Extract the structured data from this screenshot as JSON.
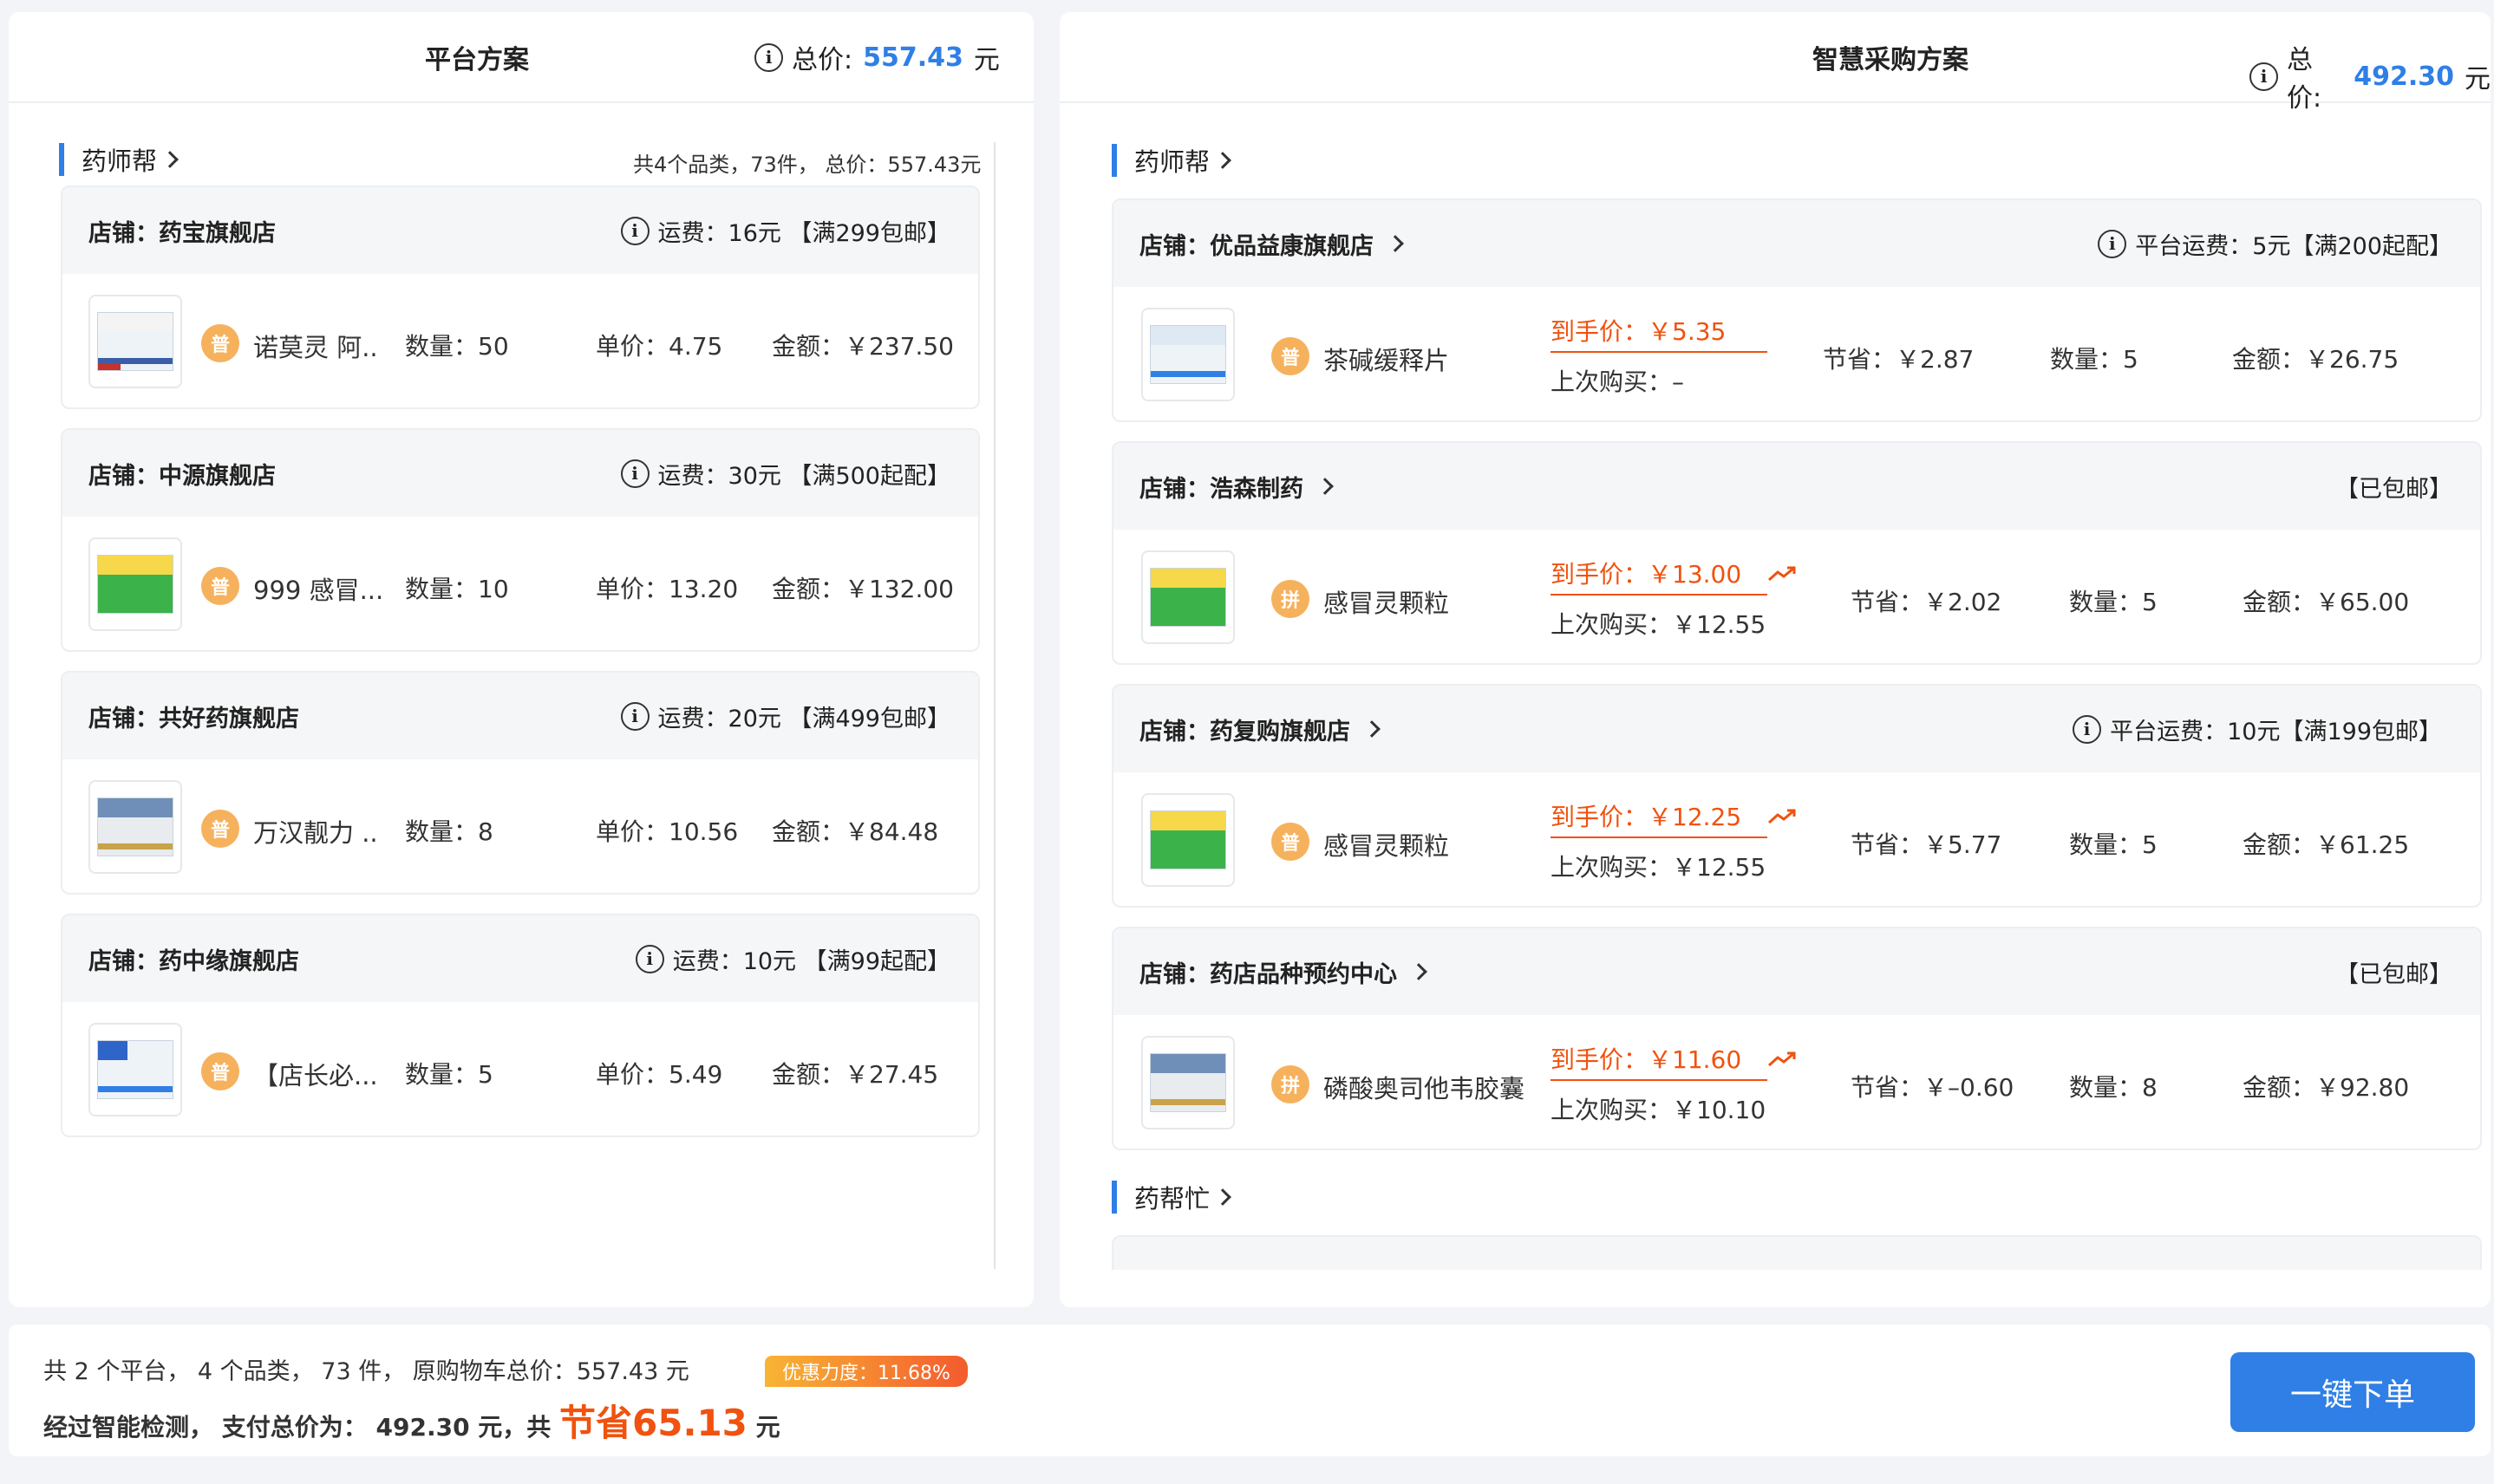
{
  "left": {
    "title": "平台方案",
    "total_label": "总价:",
    "total_value": "557.43",
    "unit": "元",
    "platform": "药师帮",
    "summary": "共4个品类，73件，  总价：557.43元",
    "stores": [
      {
        "name": "店铺：药宝旗舰店",
        "shipping": "运费：16元 【满299包邮】",
        "tag": "普",
        "product": "诺莫灵 阿..",
        "qty": "数量：50",
        "unit_price": "单价：4.75",
        "amount": "金额：￥237.50"
      },
      {
        "name": "店铺：中源旗舰店",
        "shipping": "运费：30元 【满500起配】",
        "tag": "普",
        "product": "999 感冒...",
        "qty": "数量：10",
        "unit_price": "单价：13.20",
        "amount": "金额：￥132.00"
      },
      {
        "name": "店铺：共好药旗舰店",
        "shipping": "运费：20元 【满499包邮】",
        "tag": "普",
        "product": "万汉靓力 ..",
        "qty": "数量：8",
        "unit_price": "单价：10.56",
        "amount": "金额：￥84.48"
      },
      {
        "name": "店铺：药中缘旗舰店",
        "shipping": "运费：10元 【满99起配】",
        "tag": "普",
        "product": "【店长必...",
        "qty": "数量：5",
        "unit_price": "单价：5.49",
        "amount": "金额：￥27.45"
      }
    ]
  },
  "right": {
    "title": "智慧采购方案",
    "total_label": "总价:",
    "total_value": "492.30",
    "unit": "元",
    "platforms": [
      "药师帮",
      "药帮忙"
    ],
    "stores": [
      {
        "name": "店铺：优品益康旗舰店",
        "shipping": "平台运费：5元【满200起配】",
        "tag": "普",
        "product": "茶碱缓释片",
        "deal_price": "到手价：￥5.35",
        "last_buy": "上次购买：–",
        "save": "节省：￥2.87",
        "qty": "数量：5",
        "amount": "金额：￥26.75"
      },
      {
        "name": "店铺：浩森制药",
        "shipping": "【已包邮】",
        "tag": "拼",
        "product": "感冒灵颗粒",
        "deal_price": "到手价：￥13.00",
        "last_buy": "上次购买：￥12.55",
        "save": "节省：￥2.02",
        "qty": "数量：5",
        "amount": "金额：￥65.00"
      },
      {
        "name": "店铺：药复购旗舰店",
        "shipping": "平台运费：10元【满199包邮】",
        "tag": "普",
        "product": "感冒灵颗粒",
        "deal_price": "到手价：￥12.25",
        "last_buy": "上次购买：￥12.55",
        "save": "节省：￥5.77",
        "qty": "数量：5",
        "amount": "金额：￥61.25"
      },
      {
        "name": "店铺：药店品种预约中心",
        "shipping": "【已包邮】",
        "tag": "拼",
        "product": "磷酸奥司他韦胶囊",
        "deal_price": "到手价：￥11.60",
        "last_buy": "上次购买：￥10.10",
        "save": "节省：￥–0.60",
        "qty": "数量：8",
        "amount": "金额：￥92.80"
      }
    ]
  },
  "bottom": {
    "line1": "共 2 个平台， 4 个品类， 73 件，  原购物车总价：557.43 元",
    "badge": "优惠力度：11.68%",
    "line2_prefix": "经过智能检测， 支付总价为：  492.30 元，共",
    "save_label": "节省65.13",
    "save_unit": "元",
    "button": "一键下单"
  },
  "colors": {
    "accent": "#2f7fe6",
    "orange": "#f0520f",
    "tag": "#f6b15d"
  }
}
